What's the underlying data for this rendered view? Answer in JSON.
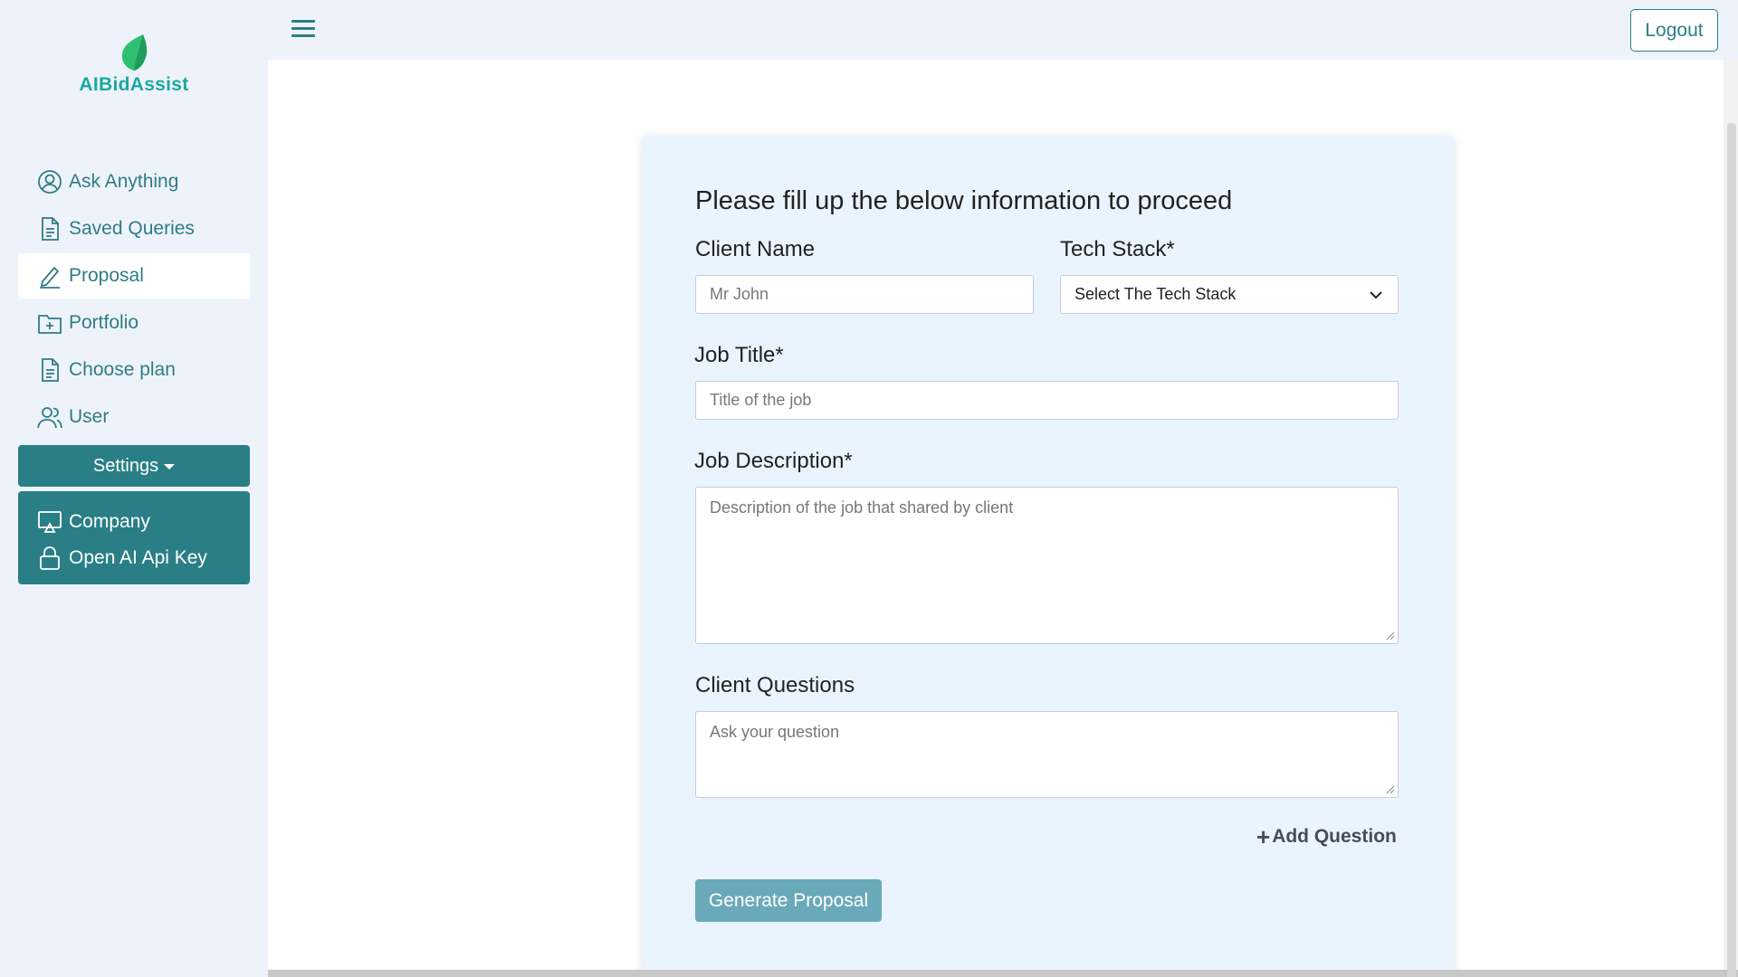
{
  "brand": {
    "name": "AIBidAssist",
    "logo_icon": "leaf-icon",
    "colors": {
      "leaf": "#2fbf71",
      "text": "#1aa99e"
    }
  },
  "sidebar": {
    "items": [
      {
        "label": "Ask Anything",
        "icon": "user-circle-icon"
      },
      {
        "label": "Saved Queries",
        "icon": "document-icon"
      },
      {
        "label": "Proposal",
        "icon": "pencil-icon",
        "active": true
      },
      {
        "label": "Portfolio",
        "icon": "folder-plus-icon"
      },
      {
        "label": "Choose plan",
        "icon": "document-icon"
      },
      {
        "label": "User",
        "icon": "users-icon"
      }
    ],
    "settings": {
      "label": "Settings",
      "items": [
        {
          "label": "Company",
          "icon": "monitor-icon"
        },
        {
          "label": "Open AI Api Key",
          "icon": "lock-icon"
        }
      ]
    }
  },
  "topbar": {
    "menu_icon": "hamburger-icon",
    "logout_label": "Logout"
  },
  "form": {
    "title": "Please fill up the below information to proceed",
    "client_name": {
      "label": "Client Name",
      "placeholder": "Mr John",
      "value": ""
    },
    "tech_stack": {
      "label": "Tech Stack*",
      "selected": "Select The Tech Stack"
    },
    "job_title": {
      "label": "Job Title*",
      "placeholder": "Title of the job",
      "value": ""
    },
    "job_description": {
      "label": "Job Description*",
      "placeholder": "Description of the job that shared by client",
      "value": ""
    },
    "client_questions": {
      "label": "Client Questions",
      "placeholder": "Ask your question",
      "value": ""
    },
    "add_question_label": "Add Question",
    "add_question_symbol": "+",
    "generate_label": "Generate Proposal"
  },
  "colors": {
    "accent": "#2a7f86",
    "sidebar_bg": "#eef3fb",
    "card_bg": "#eaf4fe",
    "generate_button": "#69a9b9"
  }
}
